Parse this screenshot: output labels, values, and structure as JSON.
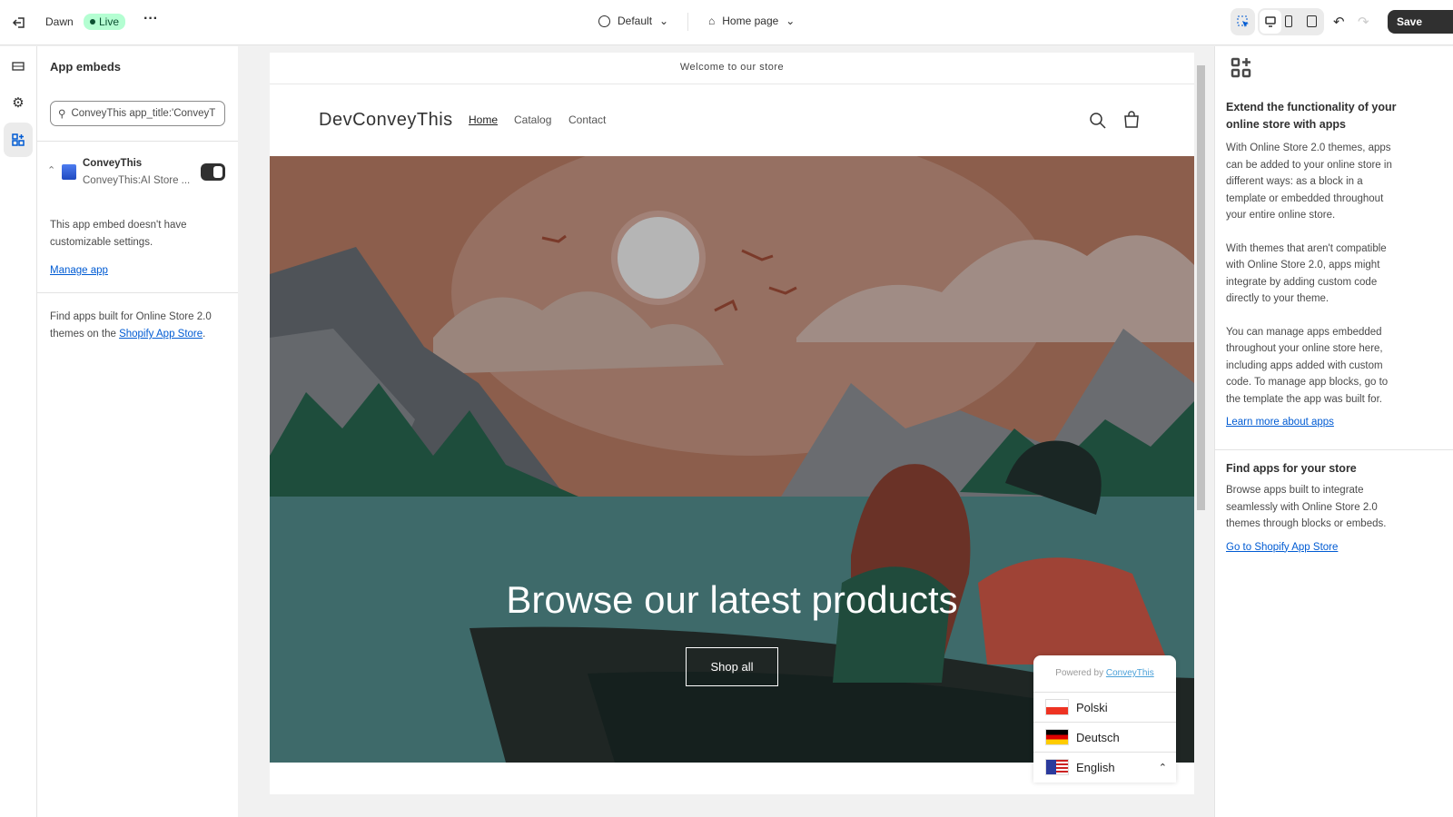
{
  "topbar": {
    "theme_name": "Dawn",
    "status": "Live",
    "template_selector": "Default",
    "page_selector": "Home page",
    "save_label": "Save"
  },
  "left_panel": {
    "title": "App embeds",
    "search_value": "ConveyThis app_title:'ConveyT",
    "app": {
      "name": "ConveyThis",
      "subtitle": "ConveyThis:AI Store ...",
      "enabled": true
    },
    "no_settings": "This app embed doesn't have customizable settings.",
    "manage_link": "Manage app",
    "find_text": "Find apps built for Online Store 2.0 themes on the ",
    "find_link": "Shopify App Store",
    "find_end": "."
  },
  "preview": {
    "announcement": "Welcome to our store",
    "logo": "DevConveyThis",
    "nav": [
      "Home",
      "Catalog",
      "Contact"
    ],
    "hero_title": "Browse our latest products",
    "hero_button": "Shop all",
    "switcher": {
      "powered_by": "Powered by ",
      "powered_link": "ConveyThis",
      "languages": [
        {
          "name": "Polski"
        },
        {
          "name": "Deutsch"
        },
        {
          "name": "English"
        }
      ]
    }
  },
  "right_panel": {
    "heading": "Extend the functionality of your online store with apps",
    "p1": "With Online Store 2.0 themes, apps can be added to your online store in different ways: as a block in a template or embedded throughout your entire online store.",
    "p2": "With themes that aren't compatible with Online Store 2.0, apps might integrate by adding custom code directly to your theme.",
    "p3": "You can manage apps embedded throughout your online store here, including apps added with custom code. To manage app blocks, go to the template the app was built for.",
    "learn_link": "Learn more about apps",
    "find_heading": "Find apps for your store",
    "find_text": "Browse apps built to integrate seamlessly with Online Store 2.0 themes through blocks or embeds.",
    "store_link": "Go to Shopify App Store"
  },
  "colors": {
    "accent": "#005bd3",
    "live_bg": "#b4fed2",
    "save_bg": "#303030"
  }
}
